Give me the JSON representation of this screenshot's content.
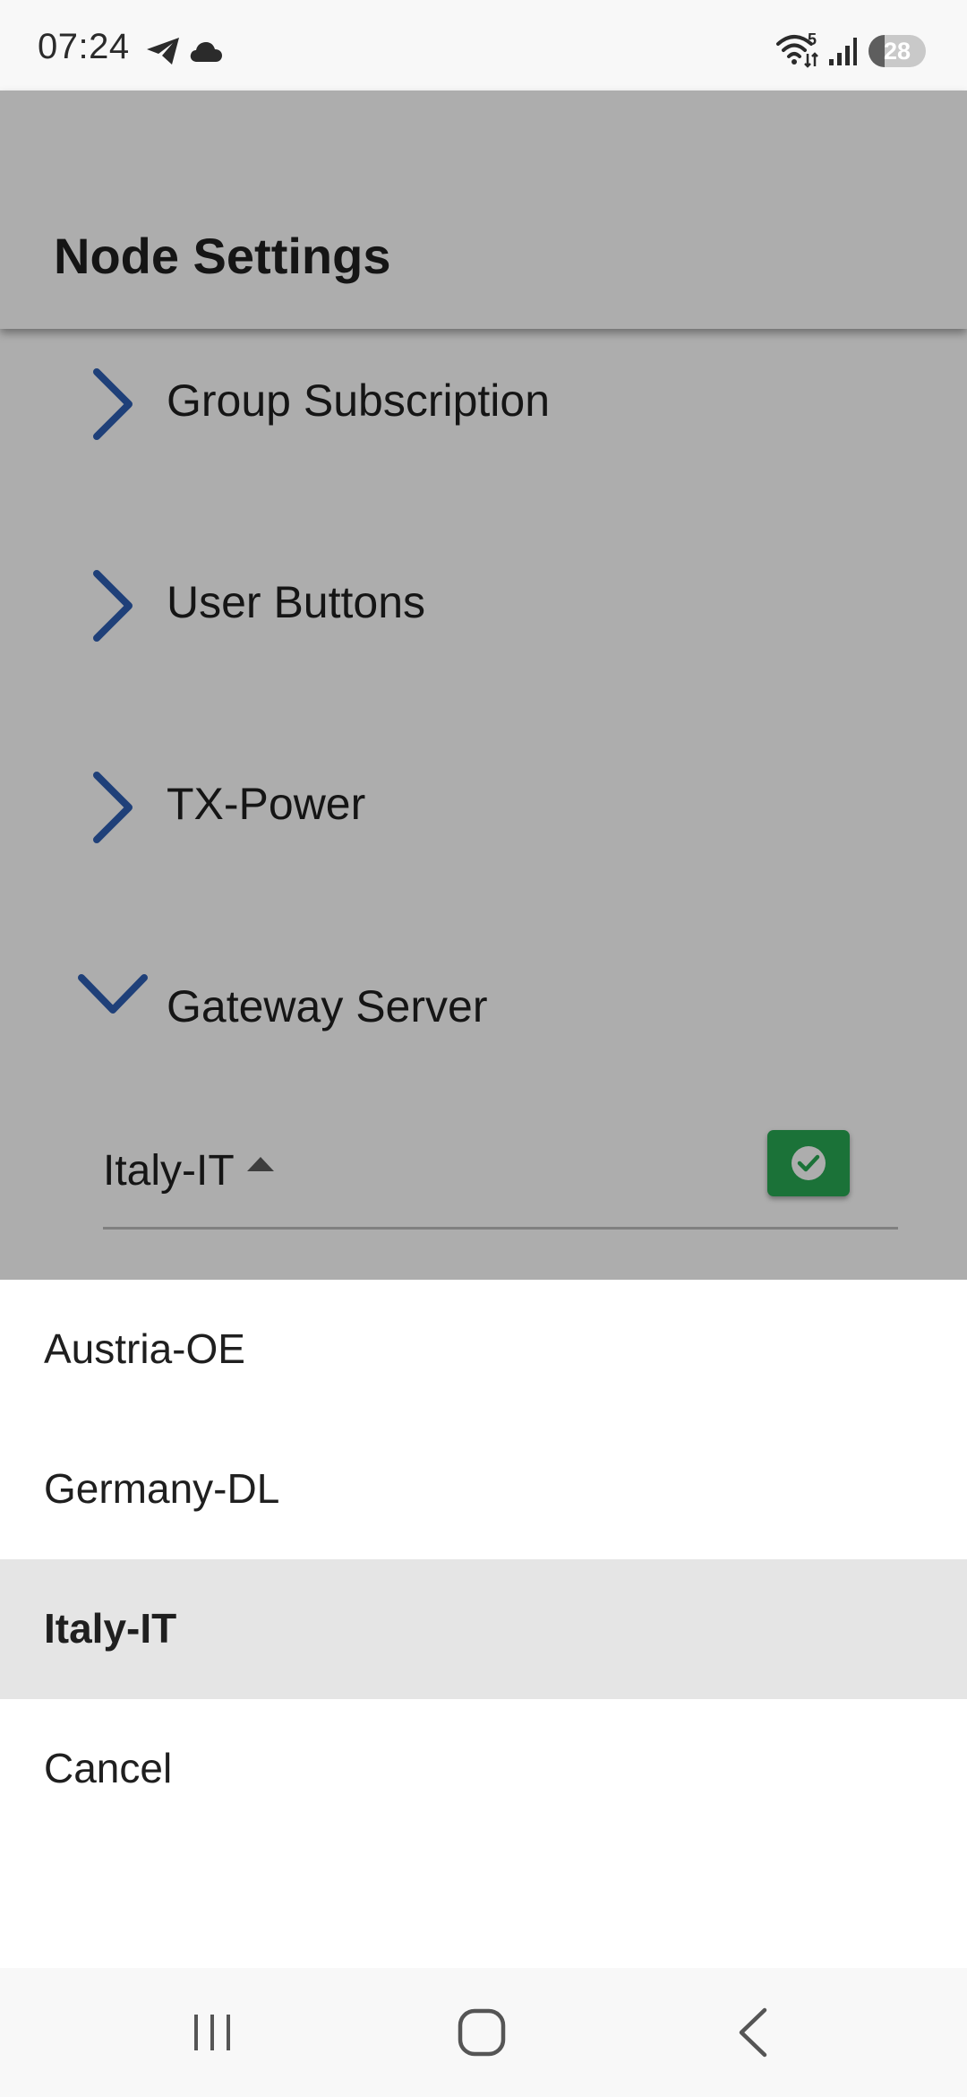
{
  "status_bar": {
    "time": "07:24",
    "icons": [
      "telegram-icon",
      "cloud-icon",
      "wifi-icon",
      "signal-icon",
      "battery-icon"
    ],
    "wifi_badge": "5",
    "battery_level": "28",
    "battery_fraction": 0.28
  },
  "header": {
    "title": "Node Settings"
  },
  "sections": [
    {
      "label": "Group Subscription",
      "expanded": false,
      "icon": "chevron-right-icon"
    },
    {
      "label": "User Buttons",
      "expanded": false,
      "icon": "chevron-right-icon"
    },
    {
      "label": "TX-Power",
      "expanded": false,
      "icon": "chevron-right-icon"
    },
    {
      "label": "Gateway Server",
      "expanded": true,
      "icon": "chevron-down-icon"
    }
  ],
  "gateway": {
    "selected_value": "Italy-IT",
    "dropdown_icon": "arrow-up-icon",
    "confirm_icon": "check-circle-icon"
  },
  "sheet": {
    "options": [
      {
        "label": "Austria-OE",
        "selected": false
      },
      {
        "label": "Germany-DL",
        "selected": false
      },
      {
        "label": "Italy-IT",
        "selected": true
      }
    ],
    "cancel_label": "Cancel"
  },
  "nav_bar": {
    "buttons": [
      "recents-icon",
      "home-icon",
      "back-icon"
    ]
  },
  "colors": {
    "accent": "#2f5fb3",
    "confirm": "#28a853",
    "selected_bg": "#e5e5e5"
  }
}
